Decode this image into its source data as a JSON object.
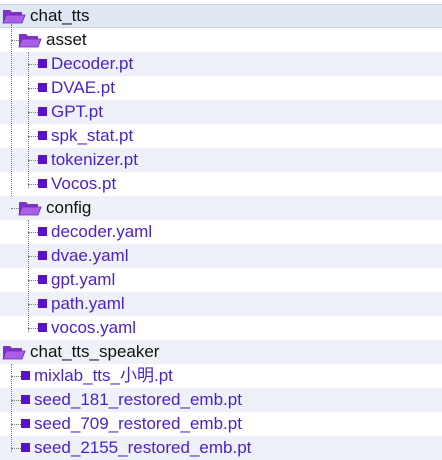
{
  "tree": {
    "root": {
      "label": "chat_tts",
      "icon": "folder-open-icon"
    },
    "asset": {
      "label": "asset",
      "icon": "folder-open-icon",
      "files": [
        "Decoder.pt",
        "DVAE.pt",
        "GPT.pt",
        "spk_stat.pt",
        "tokenizer.pt",
        "Vocos.pt"
      ]
    },
    "config": {
      "label": "config",
      "icon": "folder-open-icon",
      "files": [
        "decoder.yaml",
        "dvae.yaml",
        "gpt.yaml",
        "path.yaml",
        "vocos.yaml"
      ]
    },
    "speaker": {
      "label": "chat_tts_speaker",
      "icon": "folder-open-icon",
      "files": [
        "mixlab_tts_小明.pt",
        "seed_181_restored_emb.pt",
        "seed_709_restored_emb.pt",
        "seed_2155_restored_emb.pt"
      ]
    }
  },
  "colors": {
    "file_text": "#4b22c8",
    "file_icon": "#5a12c8",
    "folder_fill": "#a95fe6",
    "folder_back": "#7e33c4",
    "row_shade": "#eef2f8",
    "selected_row": "#dfe7f2"
  }
}
